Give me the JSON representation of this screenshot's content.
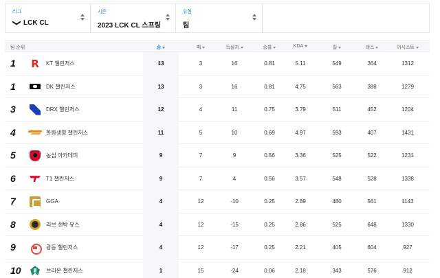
{
  "filters": [
    {
      "label": "리그",
      "value": "LCK CL",
      "logo": "lck-logo"
    },
    {
      "label": "시즌",
      "value": "2023 LCK CL 스프링"
    },
    {
      "label": "유형",
      "value": "팀"
    }
  ],
  "table": {
    "columns": [
      {
        "key": "team",
        "label": "팀 순위",
        "sortable": false
      },
      {
        "key": "wins",
        "label": "승",
        "sortable": true,
        "active": true
      },
      {
        "key": "losses",
        "label": "패",
        "sortable": true
      },
      {
        "key": "diff",
        "label": "득실차",
        "sortable": true
      },
      {
        "key": "winrate",
        "label": "승률",
        "sortable": true
      },
      {
        "key": "kda",
        "label": "KDA",
        "sortable": true
      },
      {
        "key": "kills",
        "label": "킬",
        "sortable": true
      },
      {
        "key": "deaths",
        "label": "데스",
        "sortable": true
      },
      {
        "key": "assists",
        "label": "어시스트",
        "sortable": true
      }
    ],
    "rows": [
      {
        "rank": "1",
        "logo": "kt-logo-icon",
        "team": "KT 챌린저스",
        "wins": "13",
        "losses": "3",
        "diff": "16",
        "winrate": "0.81",
        "kda": "5.11",
        "kills": "549",
        "deaths": "364",
        "assists": "1312"
      },
      {
        "rank": "1",
        "logo": "dk-logo-icon",
        "team": "DK 챌린저스",
        "wins": "13",
        "losses": "3",
        "diff": "16",
        "winrate": "0.81",
        "kda": "4.75",
        "kills": "563",
        "deaths": "388",
        "assists": "1279"
      },
      {
        "rank": "3",
        "logo": "drx-logo-icon",
        "team": "DRX 챌린저스",
        "wins": "12",
        "losses": "4",
        "diff": "11",
        "winrate": "0.75",
        "kda": "3.79",
        "kills": "511",
        "deaths": "452",
        "assists": "1204"
      },
      {
        "rank": "4",
        "logo": "hle-logo-icon",
        "team": "한화생명 챌린저스",
        "wins": "11",
        "losses": "5",
        "diff": "10",
        "winrate": "0.69",
        "kda": "4.97",
        "kills": "593",
        "deaths": "407",
        "assists": "1431"
      },
      {
        "rank": "5",
        "logo": "ns-logo-icon",
        "team": "농심 아카데미",
        "wins": "9",
        "losses": "7",
        "diff": "9",
        "winrate": "0.56",
        "kda": "3.36",
        "kills": "525",
        "deaths": "522",
        "assists": "1231"
      },
      {
        "rank": "6",
        "logo": "t1-logo-icon",
        "team": "T1 챌린저스",
        "wins": "9",
        "losses": "7",
        "diff": "4",
        "winrate": "0.56",
        "kda": "3.57",
        "kills": "548",
        "deaths": "528",
        "assists": "1338"
      },
      {
        "rank": "7",
        "logo": "gga-logo-icon",
        "team": "GGA",
        "wins": "4",
        "losses": "12",
        "diff": "-10",
        "winrate": "0.25",
        "kda": "2.89",
        "kills": "480",
        "deaths": "561",
        "assists": "1143"
      },
      {
        "rank": "8",
        "logo": "liiv-logo-icon",
        "team": "리브 샌박 유스",
        "wins": "4",
        "losses": "12",
        "diff": "-15",
        "winrate": "0.25",
        "kda": "2.86",
        "kills": "525",
        "deaths": "648",
        "assists": "1330"
      },
      {
        "rank": "9",
        "logo": "kdf-logo-icon",
        "team": "광동 챌린저스",
        "wins": "4",
        "losses": "12",
        "diff": "-17",
        "winrate": "0.25",
        "kda": "2.21",
        "kills": "405",
        "deaths": "604",
        "assists": "927"
      },
      {
        "rank": "10",
        "logo": "bro-logo-icon",
        "team": "브리온 챌린저스",
        "wins": "1",
        "losses": "15",
        "diff": "-24",
        "winrate": "0.06",
        "kda": "2.18",
        "kills": "343",
        "deaths": "576",
        "assists": "912"
      }
    ]
  },
  "colors": {
    "accent": "#3d7cdc",
    "rank_text": "#111111",
    "win_bg": "#f5f6f8"
  }
}
